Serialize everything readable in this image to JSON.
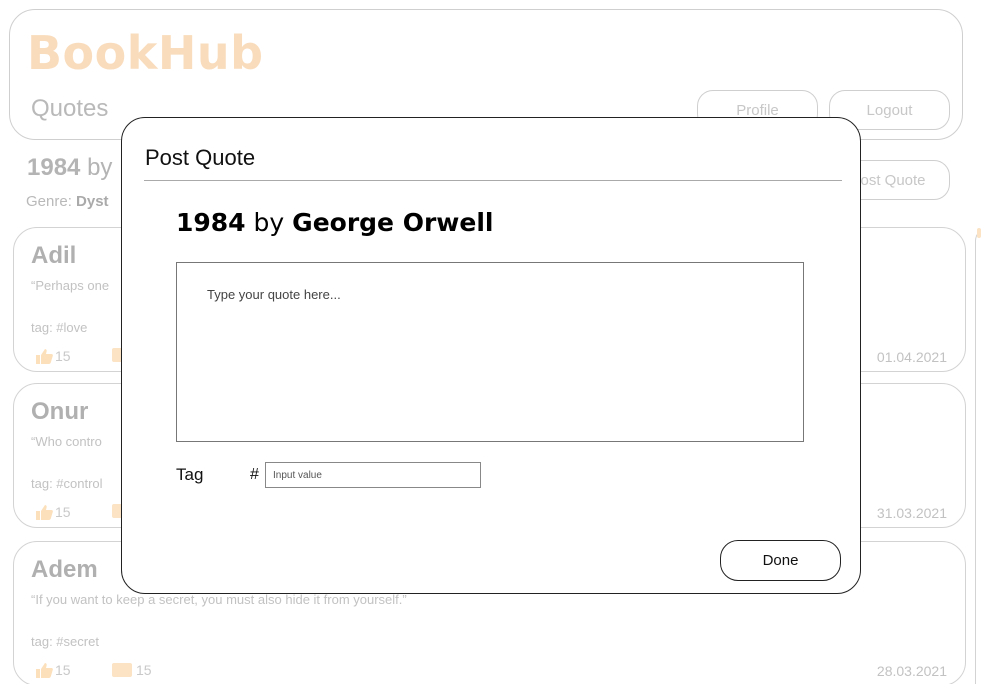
{
  "app": {
    "logo": "BookHub",
    "page_title": "Quotes",
    "brand_color": "#f9dcbc"
  },
  "header": {
    "profile_label": "Profile",
    "logout_label": "Logout",
    "post_quote_label": "Post Quote"
  },
  "book": {
    "title": "1984",
    "by": "by",
    "author": "George Orwell",
    "genre_label": "Genre:",
    "genre_partial": "Dyst"
  },
  "background_partial": {
    "title_by": "by"
  },
  "quotes": [
    {
      "user": "Adil",
      "text": "“Perhaps one",
      "tag": "tag: #love",
      "likes": "15",
      "date": "01.04.2021"
    },
    {
      "user": "Onur",
      "text": "“Who contro",
      "tag": "tag: #control",
      "likes": "15",
      "date": "31.03.2021"
    },
    {
      "user": "Adem",
      "text": "“If you want to keep a secret, you must also hide it from yourself.”",
      "tag": "tag: #secret",
      "likes": "15",
      "comments": "15",
      "date": "28.03.2021"
    }
  ],
  "modal": {
    "title": "Post Quote",
    "book_title": "1984",
    "book_by": "by",
    "book_author": "George Orwell",
    "quote_placeholder": "Type your quote here...",
    "quote_value": "",
    "tag_label": "Tag",
    "tag_prefix": "#",
    "tag_placeholder": "Input value",
    "tag_value": "",
    "done_label": "Done"
  },
  "icons": {
    "like": "thumbs-up-icon",
    "comment": "comment-icon"
  }
}
